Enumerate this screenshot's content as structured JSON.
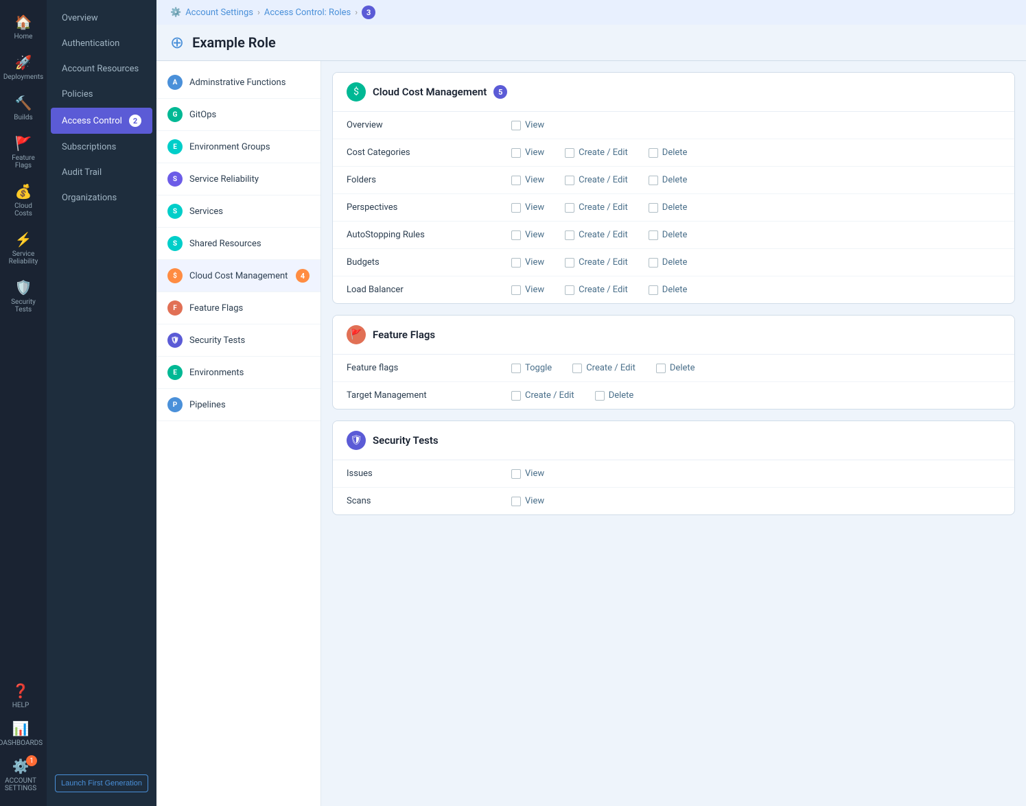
{
  "iconNav": {
    "items": [
      {
        "id": "home",
        "label": "Home",
        "icon": "🏠"
      },
      {
        "id": "deployments",
        "label": "Deployments",
        "icon": "🚀"
      },
      {
        "id": "builds",
        "label": "Builds",
        "icon": "🔨"
      },
      {
        "id": "feature-flags",
        "label": "Feature Flags",
        "icon": "🚩"
      },
      {
        "id": "cloud-costs",
        "label": "Cloud Costs",
        "icon": "💰"
      },
      {
        "id": "service-reliability",
        "label": "Service Reliability",
        "icon": "⚡"
      },
      {
        "id": "security-tests",
        "label": "Security Tests",
        "icon": "🛡️"
      }
    ],
    "bottomItems": [
      {
        "id": "help",
        "label": "HELP",
        "icon": "❓"
      },
      {
        "id": "dashboards",
        "label": "DASHBOARDS",
        "icon": "📊"
      },
      {
        "id": "account-settings",
        "label": "ACCOUNT SETTINGS",
        "icon": "⚙️",
        "badge": "1"
      }
    ]
  },
  "sidebar": {
    "items": [
      {
        "id": "overview",
        "label": "Overview"
      },
      {
        "id": "authentication",
        "label": "Authentication"
      },
      {
        "id": "account-resources",
        "label": "Account Resources"
      },
      {
        "id": "policies",
        "label": "Policies"
      },
      {
        "id": "access-control",
        "label": "Access Control",
        "active": true,
        "badge": "2"
      },
      {
        "id": "subscriptions",
        "label": "Subscriptions"
      },
      {
        "id": "audit-trail",
        "label": "Audit Trail"
      },
      {
        "id": "organizations",
        "label": "Organizations"
      }
    ],
    "launchBtn": "Launch First Generation"
  },
  "breadcrumb": {
    "items": [
      {
        "label": "Account Settings",
        "link": true
      },
      {
        "label": "Access Control: Roles",
        "link": true
      },
      {
        "badge": "3"
      }
    ]
  },
  "pageTitle": "Example Role",
  "resourceList": {
    "items": [
      {
        "id": "admin-functions",
        "label": "Adminstrative Functions",
        "color": "blue",
        "iconText": "A"
      },
      {
        "id": "gitops",
        "label": "GitOps",
        "color": "green",
        "iconText": "G"
      },
      {
        "id": "environment-groups",
        "label": "Environment Groups",
        "color": "teal",
        "iconText": "E"
      },
      {
        "id": "service-reliability",
        "label": "Service Reliability",
        "color": "purple",
        "iconText": "S"
      },
      {
        "id": "services",
        "label": "Services",
        "color": "teal",
        "iconText": "S"
      },
      {
        "id": "shared-resources",
        "label": "Shared Resources",
        "color": "teal",
        "iconText": "S"
      },
      {
        "id": "cloud-cost-management",
        "label": "Cloud Cost Management",
        "color": "amber",
        "iconText": "$",
        "active": true,
        "badge": "4"
      },
      {
        "id": "feature-flags",
        "label": "Feature Flags",
        "color": "orange",
        "iconText": "F"
      },
      {
        "id": "security-tests",
        "label": "Security Tests",
        "color": "indigo",
        "iconText": "🛡"
      },
      {
        "id": "environments",
        "label": "Environments",
        "color": "env",
        "iconText": "E"
      },
      {
        "id": "pipelines",
        "label": "Pipelines",
        "color": "pipe",
        "iconText": "P"
      }
    ]
  },
  "permissionSections": [
    {
      "id": "cloud-cost-management",
      "title": "Cloud Cost Management",
      "iconText": "$",
      "iconColor": "#00b894",
      "badge": "5",
      "rows": [
        {
          "name": "Overview",
          "actions": [
            {
              "label": "View"
            }
          ]
        },
        {
          "name": "Cost Categories",
          "actions": [
            {
              "label": "View"
            },
            {
              "label": "Create / Edit"
            },
            {
              "label": "Delete"
            }
          ]
        },
        {
          "name": "Folders",
          "actions": [
            {
              "label": "View"
            },
            {
              "label": "Create / Edit"
            },
            {
              "label": "Delete"
            }
          ]
        },
        {
          "name": "Perspectives",
          "actions": [
            {
              "label": "View"
            },
            {
              "label": "Create / Edit"
            },
            {
              "label": "Delete"
            }
          ]
        },
        {
          "name": "AutoStopping Rules",
          "actions": [
            {
              "label": "View"
            },
            {
              "label": "Create / Edit"
            },
            {
              "label": "Delete"
            }
          ]
        },
        {
          "name": "Budgets",
          "actions": [
            {
              "label": "View"
            },
            {
              "label": "Create / Edit"
            },
            {
              "label": "Delete"
            }
          ]
        },
        {
          "name": "Load Balancer",
          "actions": [
            {
              "label": "View"
            },
            {
              "label": "Create / Edit"
            },
            {
              "label": "Delete"
            }
          ]
        }
      ]
    },
    {
      "id": "feature-flags",
      "title": "Feature Flags",
      "iconText": "🚩",
      "iconColor": "#e17055",
      "rows": [
        {
          "name": "Feature flags",
          "actions": [
            {
              "label": "Toggle"
            },
            {
              "label": "Create / Edit"
            },
            {
              "label": "Delete"
            }
          ]
        },
        {
          "name": "Target Management",
          "actions": [
            {
              "label": "Create / Edit"
            },
            {
              "label": "Delete"
            }
          ]
        }
      ]
    },
    {
      "id": "security-tests",
      "title": "Security Tests",
      "iconText": "🛡",
      "iconColor": "#5b5bd6",
      "rows": [
        {
          "name": "Issues",
          "actions": [
            {
              "label": "View"
            }
          ]
        },
        {
          "name": "Scans",
          "actions": [
            {
              "label": "View"
            }
          ]
        }
      ]
    }
  ]
}
